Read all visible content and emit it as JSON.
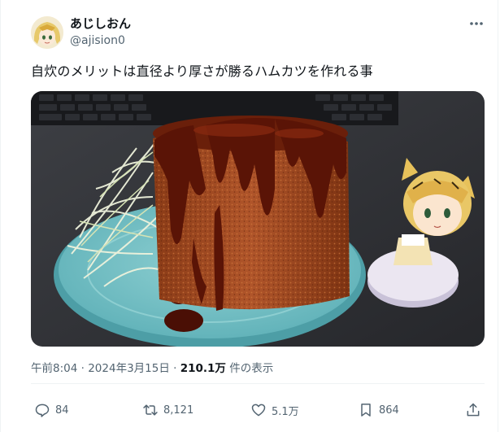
{
  "author": {
    "display_name": "あじしおん",
    "handle": "@ajision0"
  },
  "tweet": {
    "text": "自炊のメリットは直径より厚さが勝るハムカツを作れる事"
  },
  "meta": {
    "time": "午前8:04",
    "separator1": "·",
    "date": "2024年3月15日",
    "separator2": "·",
    "views_count": "210.1万",
    "views_label": "件の表示"
  },
  "actions": {
    "replies": "84",
    "reposts": "8,121",
    "likes": "5.1万",
    "bookmarks": "864"
  },
  "icons": [
    "more-icon",
    "reply-icon",
    "repost-icon",
    "like-icon",
    "bookmark-icon",
    "share-icon"
  ],
  "colors": {
    "text": "#0f1419",
    "muted": "#536471",
    "divider": "#eff3f4"
  }
}
